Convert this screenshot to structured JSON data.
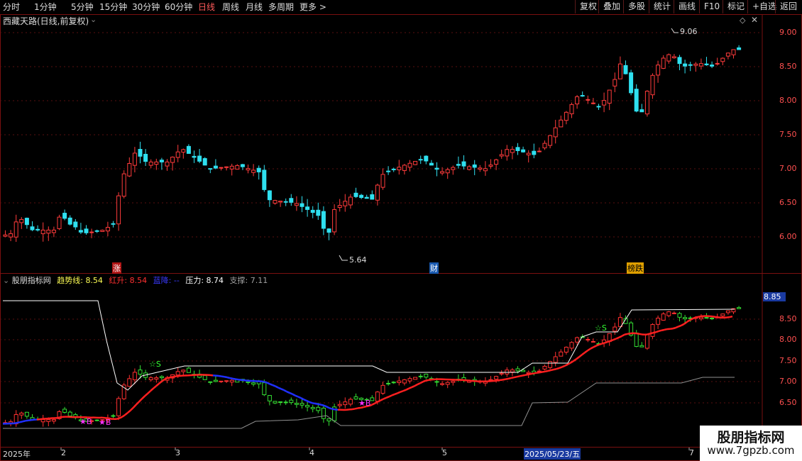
{
  "toolbar": {
    "periods": [
      "分时",
      "1分钟",
      "5分钟",
      "15分钟",
      "30分钟",
      "60分钟",
      "日线",
      "周线",
      "月线",
      "多周期",
      "更多 >"
    ],
    "active_period": "日线",
    "buttons": [
      "复权",
      "叠加",
      "多股",
      "统计",
      "画线",
      "F10",
      "标记",
      "+自选",
      "返回"
    ]
  },
  "main_chart": {
    "title": "西藏天路(日线,前复权)",
    "high_marker": "9.06",
    "low_marker": "5.64",
    "y_ticks": [
      "9.00",
      "8.50",
      "8.00",
      "7.50",
      "7.00",
      "6.50",
      "6.00"
    ],
    "event_tags": [
      {
        "text": "涨",
        "color": "#ff3b3b"
      },
      {
        "text": "财",
        "color": "#4aa3ff"
      },
      {
        "text": "榜跌",
        "color": "#ffb000"
      }
    ]
  },
  "indicator": {
    "name": "股朋指标网",
    "legend": [
      {
        "label": "趋势线:",
        "value": "8.54",
        "color": "#ffff55"
      },
      {
        "label": "红升:",
        "value": "8.54",
        "color": "#ff3030"
      },
      {
        "label": "蓝降:",
        "value": "--",
        "color": "#3a3aff"
      },
      {
        "label": "压力:",
        "value": "8.74",
        "color": "#ffffff"
      },
      {
        "label": "支撑:",
        "value": "7.11",
        "color": "#a0a0a0"
      }
    ],
    "current_price_tag": "8.85",
    "y_ticks": [
      "8.50",
      "8.00",
      "7.50",
      "7.00",
      "6.50"
    ],
    "signal_labels": [
      "☆S",
      "☆S",
      "★B",
      "★B",
      "★B"
    ]
  },
  "time_axis": {
    "labels": [
      "2025年",
      "2",
      "3",
      "4",
      "5",
      "2025/05/23/五",
      "7"
    ]
  },
  "watermark": {
    "line1": "股朋指标网",
    "line2": "www.7gpzb.com"
  },
  "colors": {
    "up": "#ff3b3b",
    "down": "#2fe0f0",
    "trend_up": "#ff2020",
    "trend_down": "#2030ff",
    "border": "#7a1010"
  }
}
